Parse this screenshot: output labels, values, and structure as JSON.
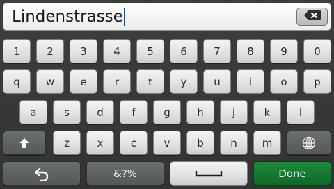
{
  "input": {
    "text": "Lindenstrasse"
  },
  "icons": {
    "backspace": "backspace-icon",
    "shift": "shift-arrow-icon",
    "globe": "globe-icon",
    "back": "back-arrow-icon",
    "space": "space-bar-icon"
  },
  "keyboard": {
    "row1": [
      "1",
      "2",
      "3",
      "4",
      "5",
      "6",
      "7",
      "8",
      "9",
      "0"
    ],
    "row2": [
      "q",
      "w",
      "e",
      "r",
      "t",
      "y",
      "u",
      "i",
      "o",
      "p"
    ],
    "row3": [
      "a",
      "s",
      "d",
      "f",
      "g",
      "h",
      "j",
      "k",
      "l"
    ],
    "row4": [
      "z",
      "x",
      "c",
      "v",
      "b",
      "n",
      "m"
    ],
    "symbols_label": "&?%",
    "done_label": "Done"
  },
  "colors": {
    "background": "#3a3c3b",
    "key": "#e2e4e2",
    "dark_key": "#5f6360",
    "done": "#1a7f36",
    "caret": "#1f4f9c"
  }
}
